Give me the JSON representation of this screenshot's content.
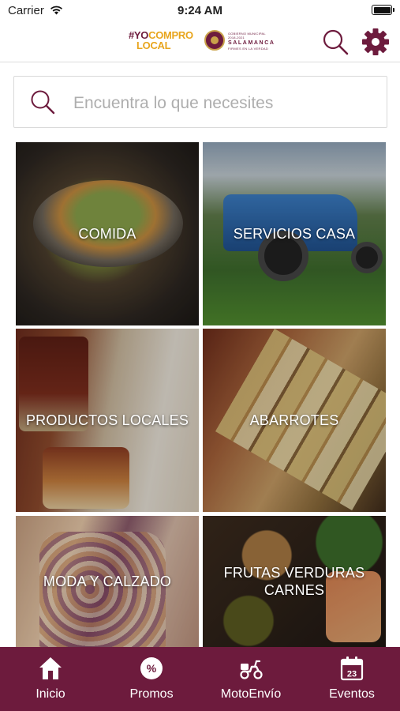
{
  "status_bar": {
    "carrier": "Carrier",
    "time": "9:24 AM"
  },
  "header": {
    "logo": {
      "line1_hash": "#YO",
      "line1": "COMPRO",
      "line2": "LOCAL"
    },
    "municipality": {
      "line1": "GOBIERNO MUNICIPAL 2018-2021",
      "line2": "SALAMANCA",
      "line3": "FIRMES EN LA VERDAD"
    }
  },
  "search": {
    "placeholder": "Encuentra lo que necesites",
    "value": ""
  },
  "categories": [
    {
      "label": "COMIDA"
    },
    {
      "label": "SERVICIOS CASA"
    },
    {
      "label": "PRODUCTOS LOCALES"
    },
    {
      "label": "ABARROTES"
    },
    {
      "label": "MODA Y CALZADO"
    },
    {
      "label": "FRUTAS VERDURAS CARNES"
    }
  ],
  "tabbar": {
    "tabs": [
      {
        "label": "Inicio",
        "icon": "home-icon"
      },
      {
        "label": "Promos",
        "icon": "percent-badge-icon"
      },
      {
        "label": "MotoEnvío",
        "icon": "scooter-icon"
      },
      {
        "label": "Eventos",
        "icon": "calendar-icon",
        "day": "23"
      }
    ]
  },
  "colors": {
    "brand": "#6d1b3d",
    "accent": "#e8a51d",
    "tab_text": "#ffffff"
  }
}
